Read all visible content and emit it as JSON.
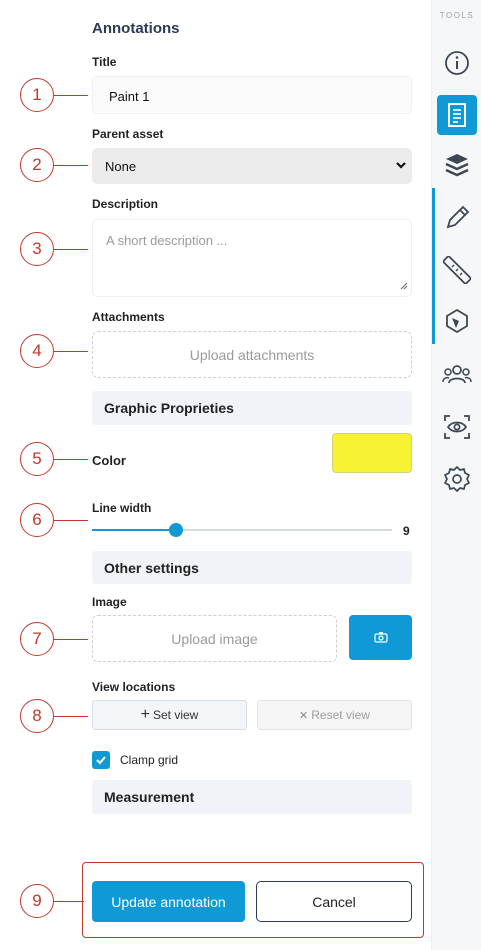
{
  "panel": {
    "heading": "Annotations",
    "title_label": "Title",
    "title_value": "Paint 1",
    "parent_label": "Parent asset",
    "parent_value": "None",
    "description_label": "Description",
    "description_placeholder": "A short description ...",
    "attachments_label": "Attachments",
    "attachments_upload": "Upload attachments",
    "graphic_section": "Graphic Proprieties",
    "color_label": "Color",
    "color_value": "#f7f232",
    "line_width_label": "Line width",
    "line_width_value": "9",
    "line_width_fraction": 0.28,
    "other_section": "Other settings",
    "image_label": "Image",
    "image_upload": "Upload image",
    "view_locations_label": "View locations",
    "set_view": "Set view",
    "reset_view": "Reset view",
    "clamp_grid_label": "Clamp grid",
    "clamp_grid_checked": true,
    "measurement_section": "Measurement",
    "update_button": "Update annotation",
    "cancel_button": "Cancel"
  },
  "callouts": [
    "1",
    "2",
    "3",
    "4",
    "5",
    "6",
    "7",
    "8",
    "9"
  ],
  "toolbar": {
    "label": "TOOLS",
    "items": [
      "info-icon",
      "document-icon",
      "layers-icon",
      "pencil-icon",
      "ruler-icon",
      "shape-icon",
      "users-icon",
      "eye-scan-icon",
      "settings-icon"
    ],
    "active": "document-icon"
  },
  "colors": {
    "accent": "#0f9ad6",
    "callout": "#c0392b",
    "heading": "#2b3a55",
    "section_bg": "#f0f4f8"
  }
}
